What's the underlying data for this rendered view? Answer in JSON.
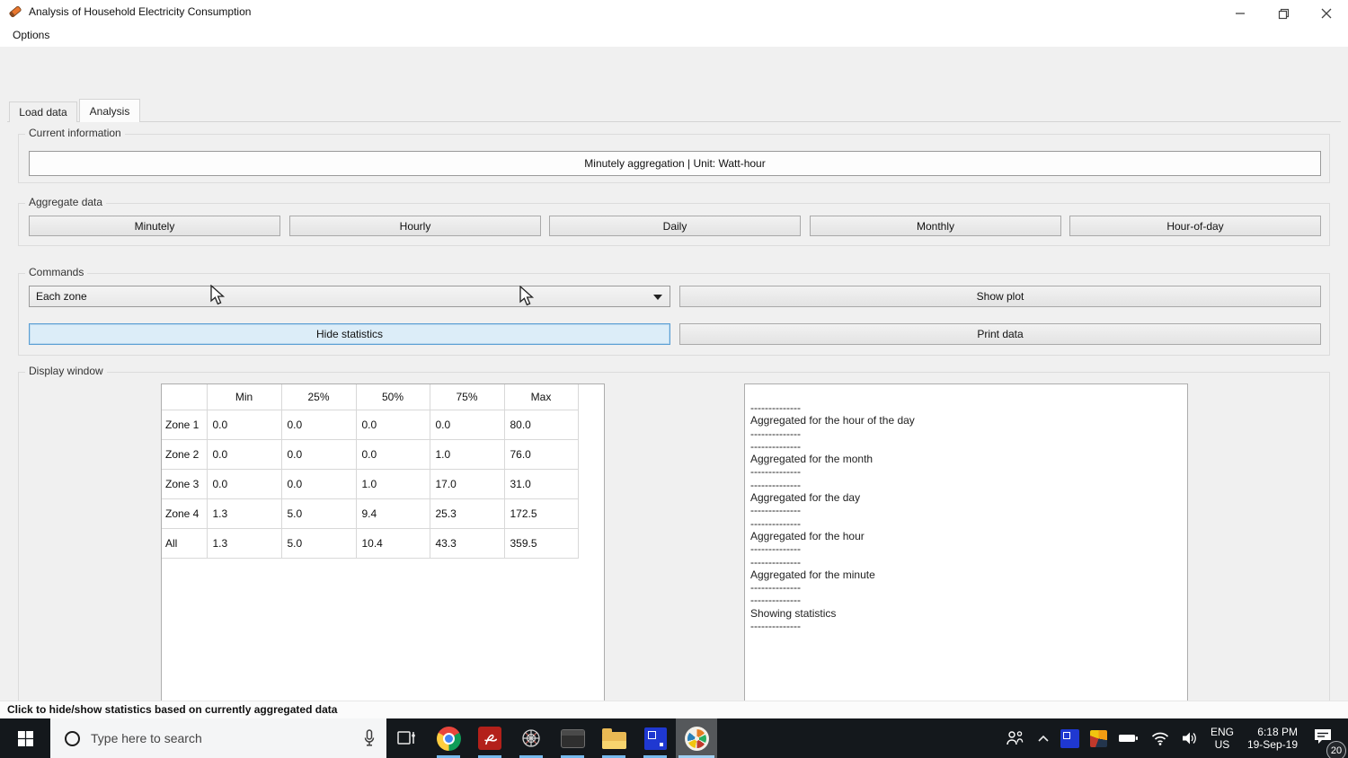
{
  "window": {
    "title": "Analysis of Household Electricity Consumption"
  },
  "menu": {
    "options_label": "Options"
  },
  "tabs": [
    {
      "label": "Load data",
      "selected": false
    },
    {
      "label": "Analysis",
      "selected": true
    }
  ],
  "current_information": {
    "group_label": "Current information",
    "value": "Minutely aggregation | Unit: Watt-hour"
  },
  "aggregate_data": {
    "group_label": "Aggregate data",
    "buttons": [
      "Minutely",
      "Hourly",
      "Daily",
      "Monthly",
      "Hour-of-day"
    ]
  },
  "commands": {
    "group_label": "Commands",
    "zone_select": {
      "value": "Each zone"
    },
    "show_plot_label": "Show plot",
    "hide_statistics_label": "Hide statistics",
    "print_data_label": "Print data"
  },
  "display_window": {
    "group_label": "Display window",
    "statistics_table": {
      "type": "table",
      "columns": [
        "",
        "Min",
        "25%",
        "50%",
        "75%",
        "Max"
      ],
      "rows": [
        {
          "label": "Zone 1",
          "values": [
            "0.0",
            "0.0",
            "0.0",
            "0.0",
            "80.0"
          ]
        },
        {
          "label": "Zone 2",
          "values": [
            "0.0",
            "0.0",
            "0.0",
            "1.0",
            "76.0"
          ]
        },
        {
          "label": "Zone 3",
          "values": [
            "0.0",
            "0.0",
            "1.0",
            "17.0",
            "31.0"
          ]
        },
        {
          "label": "Zone 4",
          "values": [
            "1.3",
            "5.0",
            "9.4",
            "25.3",
            "172.5"
          ]
        },
        {
          "label": "All",
          "values": [
            "1.3",
            "5.0",
            "10.4",
            "43.3",
            "359.5"
          ]
        }
      ]
    },
    "log_lines": [
      "--------------",
      "Aggregated for the hour of the day",
      "--------------",
      "--------------",
      "Aggregated for the month",
      "--------------",
      "--------------",
      "Aggregated for the day",
      "--------------",
      "--------------",
      "Aggregated for the hour",
      "--------------",
      "--------------",
      "Aggregated for the minute",
      "--------------",
      "--------------",
      "Showing statistics",
      "--------------"
    ]
  },
  "status_bar": {
    "text": "Click to hide/show statistics based on currently aggregated data"
  },
  "taskbar": {
    "search": {
      "placeholder": "Type here to search"
    },
    "pinned_icons": [
      "task-view",
      "chrome",
      "acrobat",
      "web-app",
      "terminal",
      "file-explorer",
      "blue-remote-app",
      "analysis-app-running"
    ],
    "tray": {
      "language": "ENG",
      "region": "US",
      "time": "6:18 PM",
      "date": "19-Sep-19",
      "notification_count": "20"
    }
  },
  "colors": {
    "focused_button_bg": "#dcedf8",
    "focused_button_border": "#5b9fd4",
    "taskbar_bg": "#14181c",
    "running_indicator": "#76b9ed",
    "app_icon_orange": "#e8762d"
  }
}
